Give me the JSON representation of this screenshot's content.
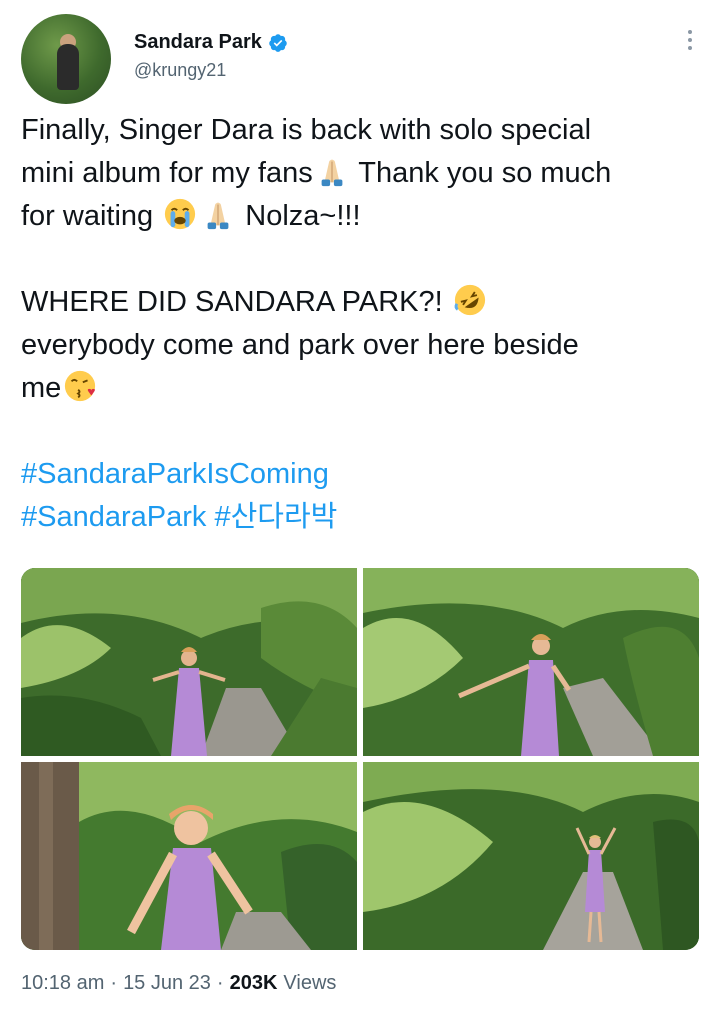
{
  "author": {
    "display_name": "Sandara Park",
    "handle": "@krungy21",
    "verified": true
  },
  "tweet": {
    "line1": "Finally, Singer Dara is back with solo special",
    "line2a": "mini album for my fans",
    "line2b": " Thank you so much",
    "line3a": "for waiting ",
    "line3b": " Nolza~!!!",
    "line4": "WHERE DID SANDARA PARK?! ",
    "line5": "everybody come and park over here beside",
    "line6": "me",
    "hashtag1": "#SandaraParkIsComing",
    "hashtag2": "#SandaraPark",
    "hashtag3": "#산다라박"
  },
  "emoji_icons": [
    "folded-hands-icon",
    "loudly-crying-face-icon",
    "folded-hands-icon",
    "rolling-on-floor-laughing-icon",
    "face-blowing-kiss-icon"
  ],
  "media": {
    "count": 4
  },
  "meta": {
    "time": "10:18 am",
    "date": "15 Jun 23",
    "views_count": "203K",
    "views_label": "Views",
    "sep": "·"
  },
  "colors": {
    "text": "#0f1419",
    "secondary": "#536471",
    "link": "#1d9bf0",
    "verified": "#1d9bf0",
    "dress": "#b58ad6"
  }
}
